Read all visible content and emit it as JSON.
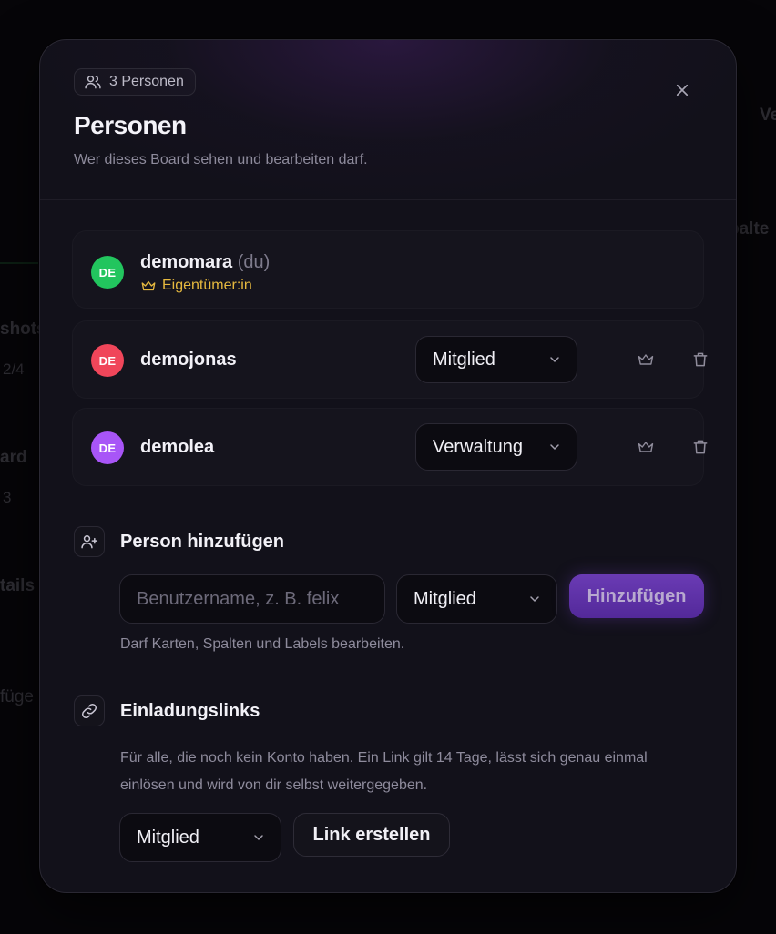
{
  "background": {
    "fragments": [
      "Ve",
      "palte",
      "shots",
      "2/4",
      "ard",
      "3",
      "tails",
      "füge"
    ]
  },
  "modal": {
    "count_chip": "3 Personen",
    "title": "Personen",
    "subtitle": "Wer dieses Board sehen und bearbeiten darf.",
    "members": [
      {
        "initials": "DE",
        "avatar_color": "#22c55e",
        "name": "demomara",
        "you_suffix": "(du)",
        "owner_label": "Eigentümer:in"
      },
      {
        "initials": "DE",
        "avatar_color": "#f0465a",
        "name": "demojonas",
        "role": "Mitglied"
      },
      {
        "initials": "DE",
        "avatar_color": "#a855f7",
        "name": "demolea",
        "role": "Verwaltung"
      }
    ],
    "add_person": {
      "title": "Person hinzufügen",
      "input_placeholder": "Benutzername, z. B. felix",
      "input_value": "",
      "role": "Mitglied",
      "button": "Hinzufügen",
      "hint": "Darf Karten, Spalten und Labels bearbeiten."
    },
    "invite_links": {
      "title": "Einladungslinks",
      "description": "Für alle, die noch kein Konto haben. Ein Link gilt 14 Tage, lässt sich genau einmal einlösen und wird von dir selbst weitergegeben.",
      "role": "Mitglied",
      "button": "Link erstellen"
    }
  },
  "colors": {
    "accent": "#5b2ea6",
    "owner": "#e6b93f",
    "background": "#0b0a0f",
    "modal": "#12111a"
  }
}
